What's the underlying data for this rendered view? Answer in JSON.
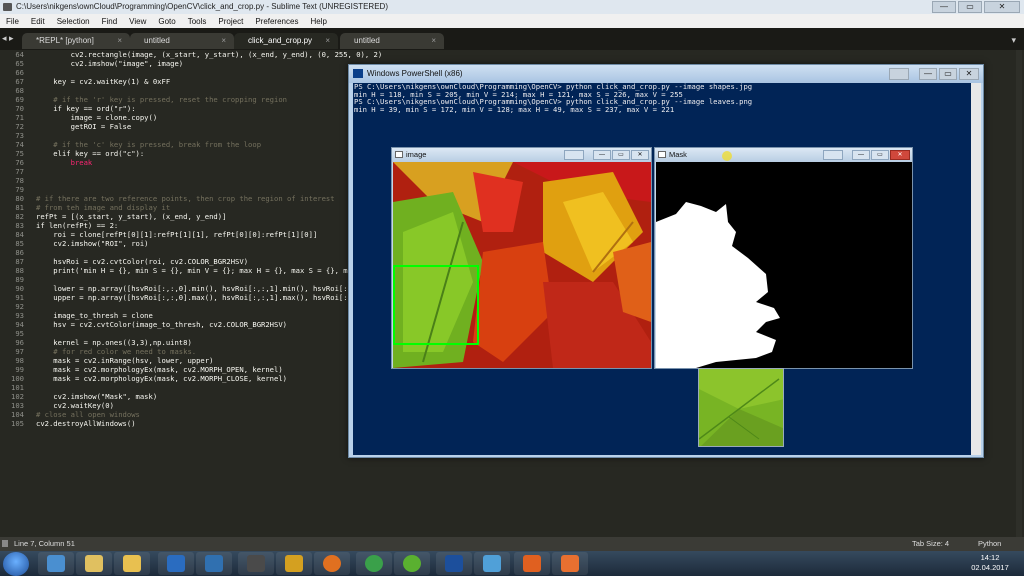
{
  "window": {
    "title": "C:\\Users\\nikgens\\ownCloud\\Programming\\OpenCV\\click_and_crop.py - Sublime Text (UNREGISTERED)",
    "btn_min": "—",
    "btn_max": "▭",
    "btn_close": "✕"
  },
  "menu": [
    "File",
    "Edit",
    "Selection",
    "Find",
    "View",
    "Goto",
    "Tools",
    "Project",
    "Preferences",
    "Help"
  ],
  "tabs": [
    {
      "label": "*REPL* [python]",
      "close": "×"
    },
    {
      "label": "untitled",
      "close": "×"
    },
    {
      "label": "click_and_crop.py",
      "close": "×"
    },
    {
      "label": "untitled",
      "close": "×"
    }
  ],
  "tab_nav": "◂ ▸",
  "tab_dropdown": "▾",
  "code_lines": [
    {
      "n": "64",
      "t": "        cv2.rectangle(image, (x_start, y_start), (x_end, y_end), (0, 255, 0), 2)",
      "c": ""
    },
    {
      "n": "65",
      "t": "        cv2.imshow(\"image\", image)",
      "c": ""
    },
    {
      "n": "66",
      "t": "",
      "c": ""
    },
    {
      "n": "67",
      "t": "    key = cv2.waitKey(1) & 0xFF",
      "c": ""
    },
    {
      "n": "68",
      "t": "",
      "c": ""
    },
    {
      "n": "69",
      "t": "    # if the 'r' key is pressed, reset the cropping region",
      "c": "cm"
    },
    {
      "n": "70",
      "t": "    if key == ord(\"r\"):",
      "c": ""
    },
    {
      "n": "71",
      "t": "        image = clone.copy()",
      "c": ""
    },
    {
      "n": "72",
      "t": "        getROI = False",
      "c": ""
    },
    {
      "n": "73",
      "t": "",
      "c": ""
    },
    {
      "n": "74",
      "t": "    # if the 'c' key is pressed, break from the loop",
      "c": "cm"
    },
    {
      "n": "75",
      "t": "    elif key == ord(\"c\"):",
      "c": ""
    },
    {
      "n": "76",
      "t": "        break",
      "c": "kw"
    },
    {
      "n": "77",
      "t": "",
      "c": ""
    },
    {
      "n": "78",
      "t": "",
      "c": ""
    },
    {
      "n": "79",
      "t": "",
      "c": ""
    },
    {
      "n": "80",
      "t": "# if there are two reference points, then crop the region of interest",
      "c": "cm"
    },
    {
      "n": "81",
      "t": "# from teh image and display it",
      "c": "cm"
    },
    {
      "n": "82",
      "t": "refPt = [(x_start, y_start), (x_end, y_end)]",
      "c": ""
    },
    {
      "n": "83",
      "t": "if len(refPt) == 2:",
      "c": ""
    },
    {
      "n": "84",
      "t": "    roi = clone[refPt[0][1]:refPt[1][1], refPt[0][0]:refPt[1][0]]",
      "c": ""
    },
    {
      "n": "85",
      "t": "    cv2.imshow(\"ROI\", roi)",
      "c": ""
    },
    {
      "n": "86",
      "t": "",
      "c": ""
    },
    {
      "n": "87",
      "t": "    hsvRoi = cv2.cvtColor(roi, cv2.COLOR_BGR2HSV)",
      "c": ""
    },
    {
      "n": "88",
      "t": "    print('min H = {}, min S = {}, min V = {}; max H = {}, max S = {}, max V = {}'",
      "c": ""
    },
    {
      "n": "89",
      "t": "",
      "c": ""
    },
    {
      "n": "90",
      "t": "    lower = np.array([hsvRoi[:,:,0].min(), hsvRoi[:,:,1].min(), hsvRoi[:,:,2].min()])",
      "c": ""
    },
    {
      "n": "91",
      "t": "    upper = np.array([hsvRoi[:,:,0].max(), hsvRoi[:,:,1].max(), hsvRoi[:,:,2].max()])",
      "c": ""
    },
    {
      "n": "92",
      "t": "",
      "c": ""
    },
    {
      "n": "93",
      "t": "    image_to_thresh = clone",
      "c": ""
    },
    {
      "n": "94",
      "t": "    hsv = cv2.cvtColor(image_to_thresh, cv2.COLOR_BGR2HSV)",
      "c": ""
    },
    {
      "n": "95",
      "t": "",
      "c": ""
    },
    {
      "n": "96",
      "t": "    kernel = np.ones((3,3),np.uint8)",
      "c": ""
    },
    {
      "n": "97",
      "t": "    # for red color we need to masks.",
      "c": "cm"
    },
    {
      "n": "98",
      "t": "    mask = cv2.inRange(hsv, lower, upper)",
      "c": ""
    },
    {
      "n": "99",
      "t": "    mask = cv2.morphologyEx(mask, cv2.MORPH_OPEN, kernel)",
      "c": ""
    },
    {
      "n": "100",
      "t": "    mask = cv2.morphologyEx(mask, cv2.MORPH_CLOSE, kernel)",
      "c": ""
    },
    {
      "n": "101",
      "t": "",
      "c": ""
    },
    {
      "n": "102",
      "t": "    cv2.imshow(\"Mask\", mask)",
      "c": ""
    },
    {
      "n": "103",
      "t": "    cv2.waitKey(0)",
      "c": ""
    },
    {
      "n": "104",
      "t": "# close all open windows",
      "c": "cm"
    },
    {
      "n": "105",
      "t": "cv2.destroyAllWindows()",
      "c": ""
    }
  ],
  "status": {
    "position": "Line 7, Column 51",
    "tab_size": "Tab Size: 4",
    "syntax": "Python"
  },
  "powershell": {
    "title": "Windows PowerShell (x86)",
    "lines": [
      "PS C:\\Users\\nikgens\\ownCloud\\Programming\\OpenCV> python click_and_crop.py --image shapes.jpg",
      "min H = 118, min S = 205, min V = 214; max H = 121, max S = 226, max V = 255",
      "PS C:\\Users\\nikgens\\ownCloud\\Programming\\OpenCV> python click_and_crop.py --image leaves.png",
      "min H = 39, min S = 172, min V = 128; max H = 49, max S = 237, max V = 221"
    ]
  },
  "image_window": {
    "title": "image"
  },
  "mask_window": {
    "title": "Mask"
  },
  "clock": {
    "time": "14:12",
    "date": "02.04.2017"
  },
  "colors": {
    "editor_bg": "#272822",
    "ps_bg": "#012456",
    "roi_rect": "#00ff00"
  },
  "taskbar_icons": [
    "explorer-icon",
    "paint-icon",
    "folder-icon",
    "visual-studio-icon",
    "network-icon",
    "sublime-icon",
    "package-icon",
    "firefox-icon",
    "chrome-icon",
    "utorrent-icon",
    "powershell-icon",
    "files-icon",
    "recorder-icon",
    "xampp-icon"
  ]
}
